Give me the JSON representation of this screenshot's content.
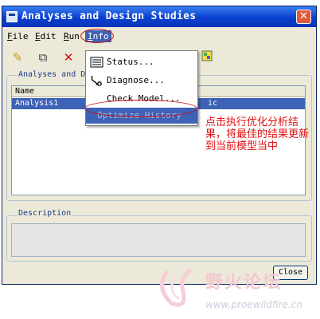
{
  "window": {
    "title": "Analyses and Design Studies",
    "close_symbol": "✕"
  },
  "menubar": {
    "items": [
      {
        "label": "File",
        "underline": "F",
        "rest": "ile"
      },
      {
        "label": "Edit",
        "underline": "E",
        "rest": "dit"
      },
      {
        "label": "Run",
        "underline": "R",
        "rest": "un"
      },
      {
        "label": "Info",
        "underline": "I",
        "rest": "nfo"
      }
    ]
  },
  "toolbar": {
    "icons": [
      "pencil-icon",
      "copy-icon",
      "delete-icon",
      "color-palette-icon"
    ]
  },
  "analyses_group": {
    "label": "Analyses and D"
  },
  "list": {
    "column_header": "Name",
    "rows": [
      {
        "name": "Analysis1",
        "tail": "ic"
      }
    ]
  },
  "info_menu": {
    "items": [
      {
        "label": "Status...",
        "icon": "status-icon",
        "enabled": true
      },
      {
        "label": "Diagnose...",
        "icon": "stethoscope-icon",
        "enabled": true
      },
      {
        "label": "Check Model...",
        "icon": "",
        "enabled": true
      },
      {
        "label": "Optimize History",
        "icon": "",
        "enabled": false
      }
    ]
  },
  "annotation": {
    "text": "点击执行优化分析结果，将最佳的结果更新到当前模型当中"
  },
  "description_group": {
    "label": "Description",
    "value": ""
  },
  "buttons": {
    "close": "Close"
  },
  "watermark": {
    "name": "野火论坛",
    "url": "www.proewildfire.cn"
  },
  "colors": {
    "title_bar": "#0a3fcf",
    "selection": "#3d62b6",
    "annotation": "#e01010",
    "window_bg": "#ece9d8"
  }
}
